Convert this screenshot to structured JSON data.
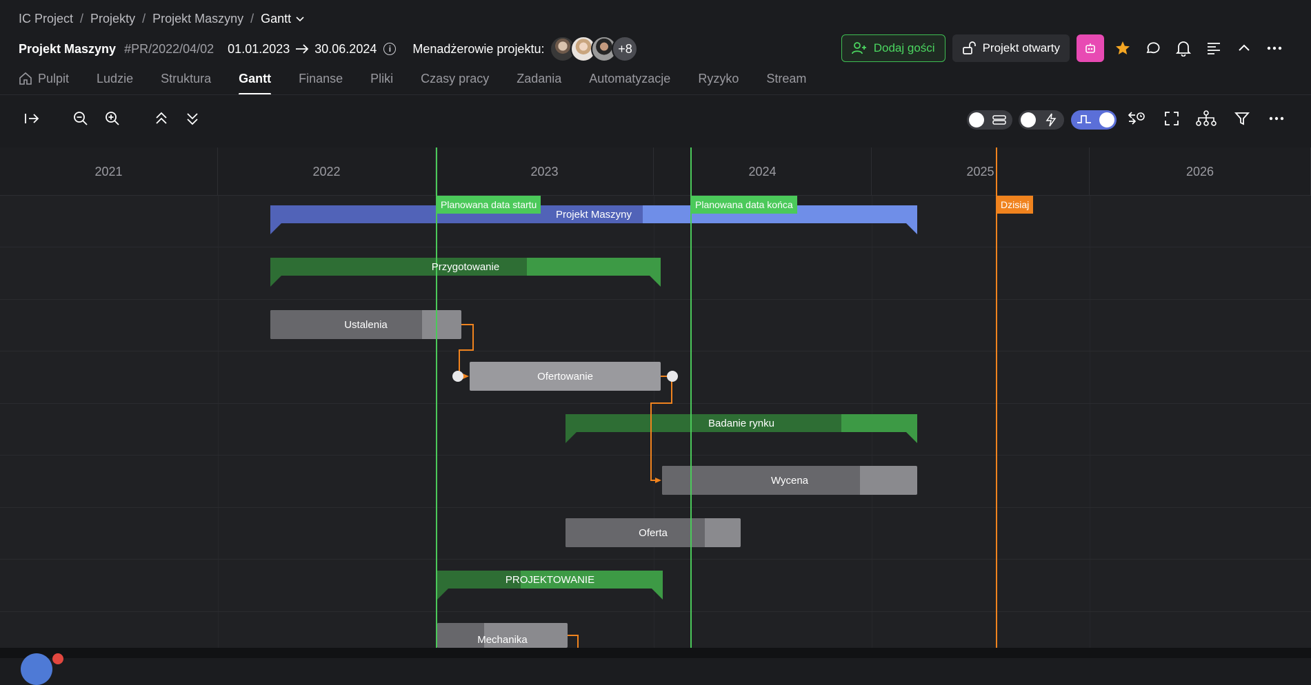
{
  "breadcrumb": {
    "root": "IC Project",
    "projects": "Projekty",
    "project": "Projekt Maszyny",
    "current": "Gantt"
  },
  "project": {
    "name": "Projekt Maszyny",
    "code": "#PR/2022/04/02",
    "start": "01.01.2023",
    "end": "30.06.2024",
    "managers_label": "Menadżerowie projektu:",
    "more_managers": "+8"
  },
  "actions": {
    "add_guests": "Dodaj gości",
    "project_open": "Projekt otwarty"
  },
  "tabs": [
    "Pulpit",
    "Ludzie",
    "Struktura",
    "Gantt",
    "Finanse",
    "Pliki",
    "Czasy pracy",
    "Zadania",
    "Automatyzacje",
    "Ryzyko",
    "Stream"
  ],
  "active_tab": "Gantt",
  "years": [
    "2021",
    "2022",
    "2023",
    "2024",
    "2025",
    "2026"
  ],
  "markers": {
    "planned_start": "Planowana data startu",
    "planned_end": "Planowana data końca",
    "today": "Dzisiaj"
  },
  "tasks": {
    "project": "Projekt Maszyny",
    "preparation": "Przygotowanie",
    "arrangements": "Ustalenia",
    "offering": "Ofertowanie",
    "market_research": "Badanie rynku",
    "pricing": "Wycena",
    "offer": "Oferta",
    "design": "PROJEKTOWANIE",
    "mechanics": "Mechanika"
  },
  "colors": {
    "accent_green": "#3fbf53",
    "today_orange": "#f0831e",
    "project_blue": "#6f8ee8",
    "summary_green": "#3d9a45",
    "task_grey": "#8a8a8e"
  }
}
